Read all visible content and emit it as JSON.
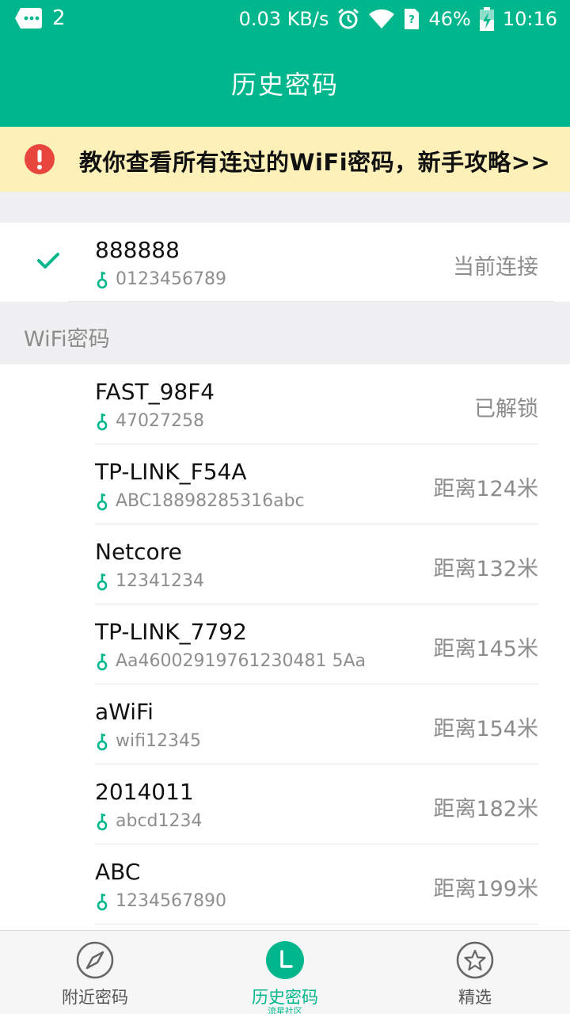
{
  "status": {
    "notification_count": "2",
    "speed": "0.03 KB/s",
    "battery": "46%",
    "time": "10:16"
  },
  "header": {
    "title": "历史密码"
  },
  "banner": {
    "text": "教你查看所有连过的WiFi密码，新手攻略>>"
  },
  "current": {
    "name": "888888",
    "password": "0123456789",
    "status": "当前连接"
  },
  "section": {
    "title": "WiFi密码"
  },
  "networks": [
    {
      "name": "FAST_98F4",
      "password": "47027258",
      "status": "已解锁"
    },
    {
      "name": "TP-LINK_F54A",
      "password": "ABC18898285316abc",
      "status": "距离124米"
    },
    {
      "name": "Netcore",
      "password": "12341234",
      "status": "距离132米"
    },
    {
      "name": "TP-LINK_7792",
      "password": "Aa46002919761230481 5Aa",
      "status": "距离145米"
    },
    {
      "name": "aWiFi",
      "password": "wifi12345",
      "status": "距离154米"
    },
    {
      "name": "2014011",
      "password": "abcd1234",
      "status": "距离182米"
    },
    {
      "name": "ABC",
      "password": "1234567890",
      "status": "距离199米"
    }
  ],
  "tabs": [
    {
      "label": "附近密码",
      "icon": "compass-icon"
    },
    {
      "label": "历史密码",
      "sublabel": "流星社区",
      "icon": "history-icon"
    },
    {
      "label": "精选",
      "icon": "star-icon"
    }
  ],
  "colors": {
    "primary": "#00b78d",
    "banner_bg": "#fdf0b8",
    "warning": "#e8453c"
  }
}
